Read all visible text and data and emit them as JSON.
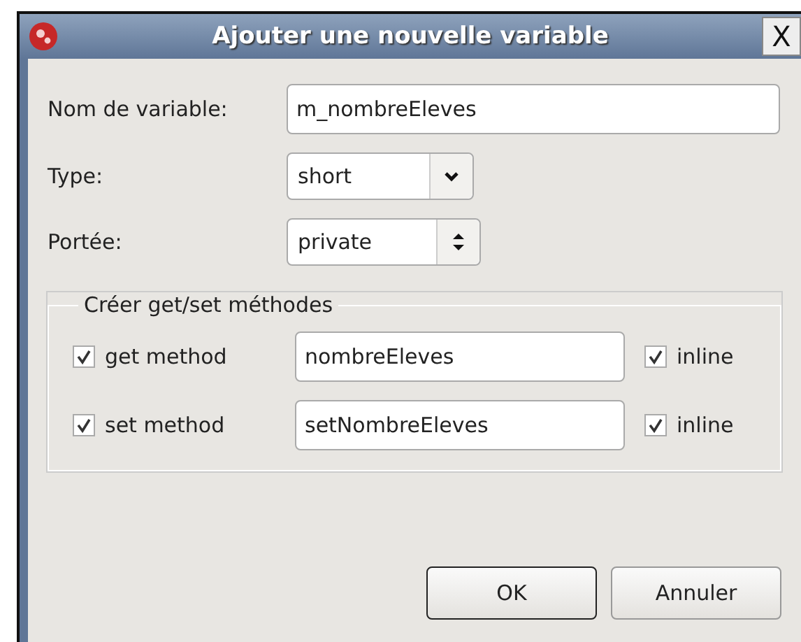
{
  "window": {
    "title": "Ajouter une nouvelle variable",
    "close": "X"
  },
  "name_field": {
    "label": "Nom de variable:",
    "value": "m_nombreEleves"
  },
  "type_field": {
    "label": "Type:",
    "value": "short",
    "kind": "dropdown"
  },
  "scope_field": {
    "label": "Portée:",
    "value": "private",
    "kind": "spinner"
  },
  "group": {
    "title": "Créer get/set méthodes",
    "rows": [
      {
        "label": "get method",
        "checked": true,
        "value": "nombreEleves",
        "inline_label": "inline",
        "inline_checked": true
      },
      {
        "label": "set method",
        "checked": true,
        "value": "setNombreEleves",
        "inline_label": "inline",
        "inline_checked": true
      }
    ]
  },
  "buttons": [
    {
      "label": "OK",
      "default": true
    },
    {
      "label": "Annuler",
      "default": false
    }
  ]
}
